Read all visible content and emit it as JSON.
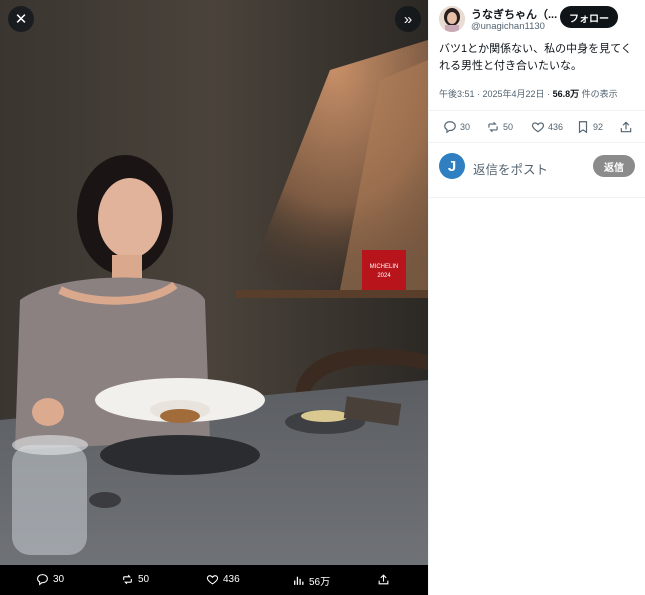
{
  "media_bar": {
    "replies": "30",
    "reposts": "50",
    "likes": "436",
    "views": "56万"
  },
  "photo_sign": {
    "line1": "MICHELIN",
    "line2": "2024"
  },
  "tweet": {
    "display_name": "うなぎちゃん（...",
    "handle": "@unagichan1130",
    "follow_label": "フォロー",
    "text": "バツ1とか関係ない、私の中身を見てくれる男性と付き合いたいな。",
    "time": "午後3:51 · 2025年4月22日 · ",
    "views_count": "56.8万",
    "views_suffix": " 件の表示",
    "replies": "30",
    "reposts": "50",
    "likes": "436",
    "bookmarks": "92"
  },
  "reply_box": {
    "avatar_letter": "J",
    "placeholder": "返信をポスト",
    "button_label": "返信"
  },
  "colors": {
    "accent": "#0f1419",
    "secondary_text": "#536471",
    "reply_button": "#8b8b8b"
  }
}
